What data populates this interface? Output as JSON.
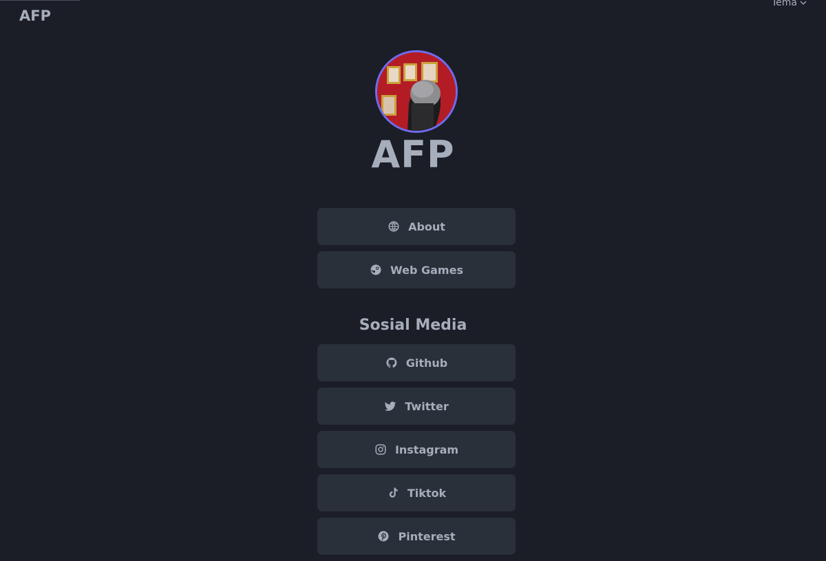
{
  "header": {
    "brand": "AFP",
    "theme_label": "Tema"
  },
  "profile": {
    "name": "AFP"
  },
  "main_links": [
    {
      "label": "About",
      "icon": "globe-icon"
    },
    {
      "label": "Web Games",
      "icon": "steam-icon"
    }
  ],
  "social": {
    "title": "Sosial Media",
    "links": [
      {
        "label": "Github",
        "icon": "github-icon"
      },
      {
        "label": "Twitter",
        "icon": "twitter-icon"
      },
      {
        "label": "Instagram",
        "icon": "instagram-icon"
      },
      {
        "label": "Tiktok",
        "icon": "tiktok-icon"
      },
      {
        "label": "Pinterest",
        "icon": "pinterest-icon"
      }
    ]
  },
  "colors": {
    "background": "#1b1e26",
    "button": "#2a3039",
    "text": "#a6adbb",
    "avatar_ring": "#6d6cf0"
  }
}
